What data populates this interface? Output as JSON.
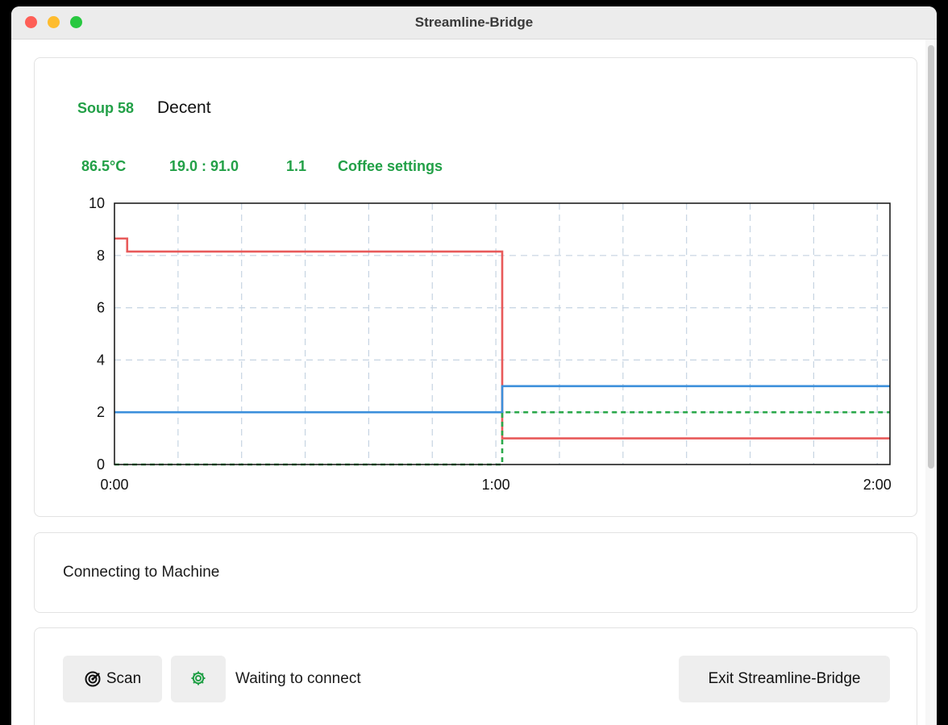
{
  "window": {
    "title": "Streamline-Bridge"
  },
  "profile": {
    "name": "Soup 58",
    "author": "Decent"
  },
  "stats": {
    "temperature": "86.5°C",
    "ratio": "19.0 : 91.0",
    "yield": "1.1",
    "settings_link": "Coffee settings"
  },
  "status": {
    "message": "Connecting to Machine"
  },
  "actions": {
    "scan_label": "Scan",
    "waiting_text": "Waiting to connect",
    "exit_label": "Exit Streamline-Bridge"
  },
  "icons": {
    "scan": "radar-icon",
    "settings": "gear-icon"
  },
  "colors": {
    "accent": "#22a047",
    "pressure": "#e85a5a",
    "flow": "#3b8fdb",
    "weight": "#2aa84a"
  },
  "chart_data": {
    "type": "line",
    "title": "",
    "xlabel": "",
    "ylabel": "",
    "xlim": [
      0,
      122
    ],
    "ylim": [
      0,
      10
    ],
    "x_ticks": [
      {
        "value": 0,
        "label": "0:00"
      },
      {
        "value": 60,
        "label": "1:00"
      },
      {
        "value": 120,
        "label": "2:00"
      }
    ],
    "y_ticks": [
      0,
      2,
      4,
      6,
      8,
      10
    ],
    "grid": true,
    "series": [
      {
        "color": "#e85a5a",
        "dashed": false,
        "points": [
          [
            0,
            8.65
          ],
          [
            2,
            8.65
          ],
          [
            2,
            8.15
          ],
          [
            61,
            8.15
          ],
          [
            61,
            1.0
          ],
          [
            122,
            1.0
          ]
        ]
      },
      {
        "color": "#3b8fdb",
        "dashed": false,
        "points": [
          [
            0,
            2.0
          ],
          [
            61,
            2.0
          ],
          [
            61,
            3.0
          ],
          [
            122,
            3.0
          ]
        ]
      },
      {
        "color": "#2aa84a",
        "dashed": true,
        "points": [
          [
            0,
            0.0
          ],
          [
            61,
            0.0
          ],
          [
            61,
            2.0
          ],
          [
            122,
            2.0
          ]
        ]
      }
    ]
  }
}
